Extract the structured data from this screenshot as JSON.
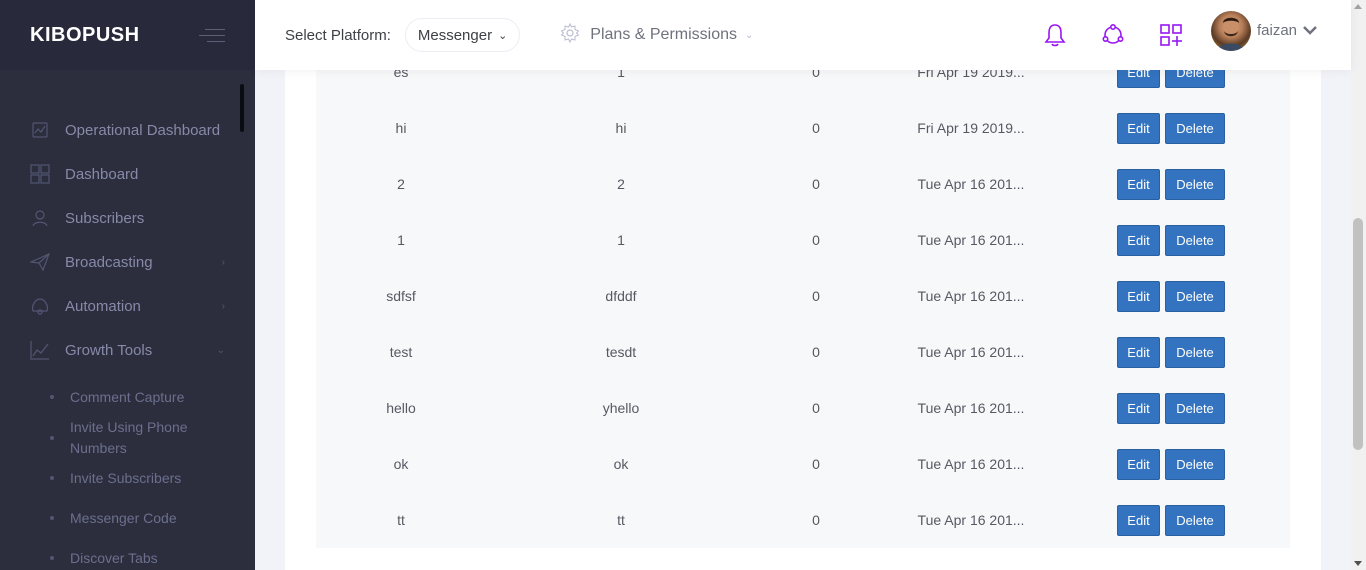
{
  "sidebar": {
    "brand": "KIBOPUSH",
    "items": [
      {
        "label": "Operational Dashboard",
        "icon": "operational-dashboard-icon",
        "arrow": ""
      },
      {
        "label": "Dashboard",
        "icon": "dashboard-icon",
        "arrow": ""
      },
      {
        "label": "Subscribers",
        "icon": "subscribers-icon",
        "arrow": ""
      },
      {
        "label": "Broadcasting",
        "icon": "paper-plane-icon",
        "arrow": "›"
      },
      {
        "label": "Automation",
        "icon": "automation-icon",
        "arrow": "›"
      },
      {
        "label": "Growth Tools",
        "icon": "chart-icon",
        "arrow": "⌄"
      }
    ],
    "subitems": [
      {
        "label": "Comment Capture"
      },
      {
        "label": "Invite Using Phone Numbers"
      },
      {
        "label": "Invite Subscribers"
      },
      {
        "label": "Messenger Code"
      },
      {
        "label": "Discover Tabs"
      }
    ]
  },
  "header": {
    "platform_label": "Select Platform:",
    "platform_value": "Messenger",
    "plans_label": "Plans & Permissions",
    "icons": [
      "bell-icon",
      "network-icon",
      "apps-grid-icon"
    ],
    "accent_color": "#9816f4",
    "username": "faizan"
  },
  "table": {
    "rows": [
      {
        "name": "es",
        "value": "1",
        "count": "0",
        "date": "Fri Apr 19 2019...",
        "edit": "Edit",
        "delete": "Delete"
      },
      {
        "name": "hi",
        "value": "hi",
        "count": "0",
        "date": "Fri Apr 19 2019...",
        "edit": "Edit",
        "delete": "Delete"
      },
      {
        "name": "2",
        "value": "2",
        "count": "0",
        "date": "Tue Apr 16 201...",
        "edit": "Edit",
        "delete": "Delete"
      },
      {
        "name": "1",
        "value": "1",
        "count": "0",
        "date": "Tue Apr 16 201...",
        "edit": "Edit",
        "delete": "Delete"
      },
      {
        "name": "sdfsf",
        "value": "dfddf",
        "count": "0",
        "date": "Tue Apr 16 201...",
        "edit": "Edit",
        "delete": "Delete"
      },
      {
        "name": "test",
        "value": "tesdt",
        "count": "0",
        "date": "Tue Apr 16 201...",
        "edit": "Edit",
        "delete": "Delete"
      },
      {
        "name": "hello",
        "value": "yhello",
        "count": "0",
        "date": "Tue Apr 16 201...",
        "edit": "Edit",
        "delete": "Delete"
      },
      {
        "name": "ok",
        "value": "ok",
        "count": "0",
        "date": "Tue Apr 16 201...",
        "edit": "Edit",
        "delete": "Delete"
      },
      {
        "name": "tt",
        "value": "tt",
        "count": "0",
        "date": "Tue Apr 16 201...",
        "edit": "Edit",
        "delete": "Delete"
      }
    ]
  },
  "colors": {
    "sidebar_bg": "#2c2e3e",
    "button_blue": "#3373bf"
  }
}
